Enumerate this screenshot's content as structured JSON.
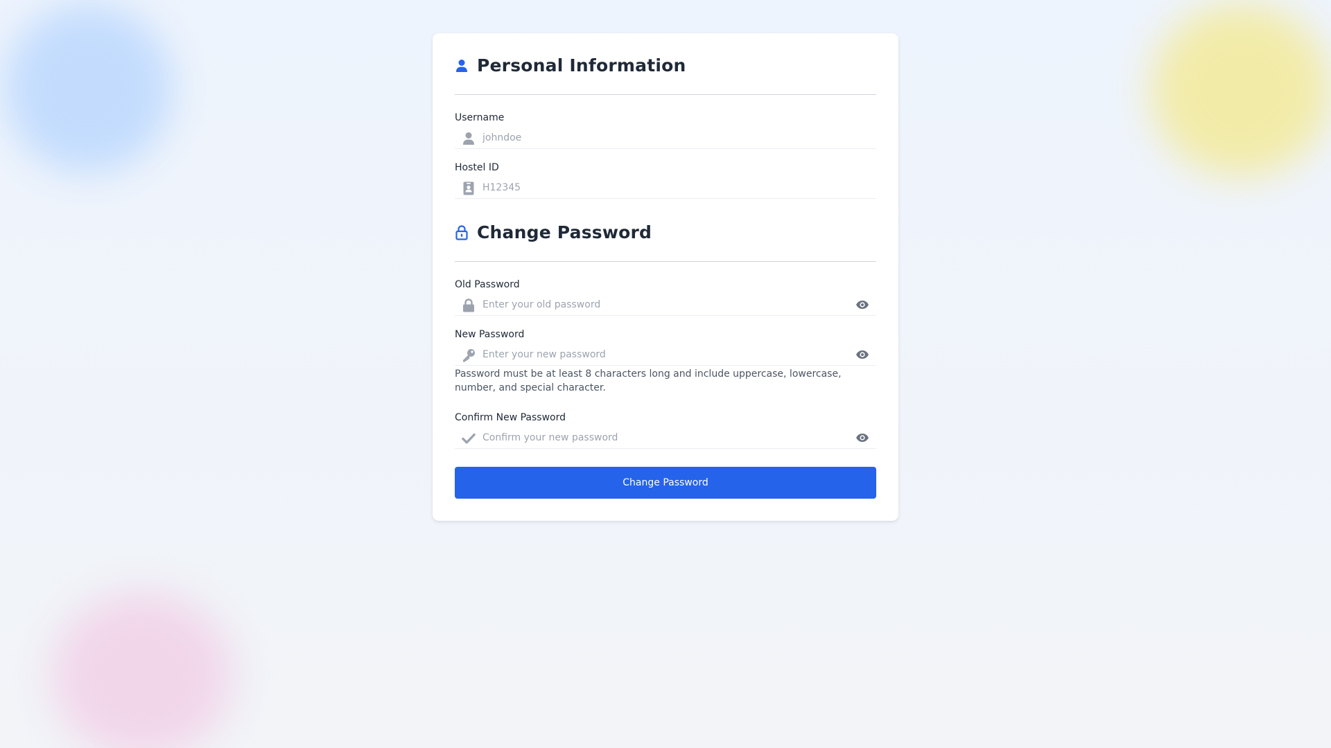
{
  "personal": {
    "title": "Personal Information",
    "icon": "user-icon",
    "username_label": "Username",
    "username_placeholder": "johndoe",
    "hostel_label": "Hostel ID",
    "hostel_placeholder": "H12345"
  },
  "password": {
    "title": "Change Password",
    "icon": "lock-open-icon",
    "old_label": "Old Password",
    "old_placeholder": "Enter your old password",
    "new_label": "New Password",
    "new_placeholder": "Enter your new password",
    "hint": "Password must be at least 8 characters long and include uppercase, lowercase, number, and special character.",
    "confirm_label": "Confirm New Password",
    "confirm_placeholder": "Confirm your new password",
    "submit_label": "Change Password"
  },
  "colors": {
    "accent": "#2563eb",
    "heading": "#1f2937",
    "icon_gray": "#9ca3af",
    "blob_blue": "#c3dcfd",
    "blob_yellow": "#f2eba8",
    "blob_pink": "#f1d6ea"
  }
}
